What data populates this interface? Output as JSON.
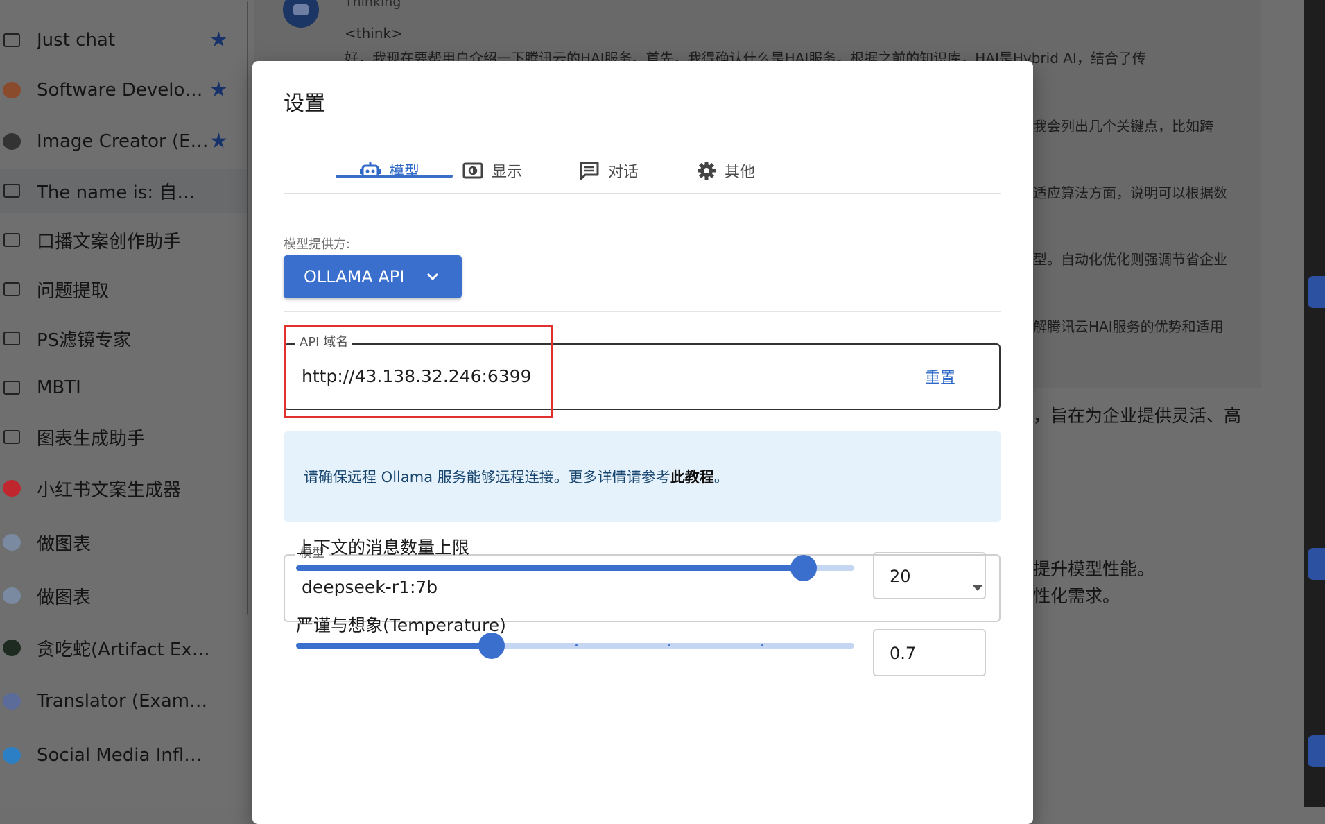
{
  "sidebar": {
    "items": [
      {
        "label": "Just chat",
        "icon": "chat-bubble-icon",
        "starred": true
      },
      {
        "label": "Software Develop…",
        "icon": "developer-avatar-icon",
        "starred": true
      },
      {
        "label": "Image Creator (E…",
        "icon": "image-icon",
        "starred": true
      },
      {
        "label": "The name is: 自我介绍",
        "icon": "chat-bubble-icon",
        "starred": false,
        "active": true
      },
      {
        "label": "口播文案创作助手",
        "icon": "chat-bubble-icon",
        "starred": false
      },
      {
        "label": "问题提取",
        "icon": "chat-bubble-icon",
        "starred": false
      },
      {
        "label": "PS滤镜专家",
        "icon": "chat-bubble-icon",
        "starred": false
      },
      {
        "label": "MBTI",
        "icon": "chat-bubble-icon",
        "starred": false
      },
      {
        "label": "图表生成助手",
        "icon": "chat-bubble-icon",
        "starred": false
      },
      {
        "label": "小红书文案生成器",
        "icon": "xiaohongshu-avatar-icon",
        "starred": false
      },
      {
        "label": "做图表",
        "icon": "chart-avatar-icon",
        "starred": false
      },
      {
        "label": "做图表",
        "icon": "chart-avatar-icon",
        "starred": false
      },
      {
        "label": "贪吃蛇(Artifact Example)",
        "icon": "snake-game-avatar-icon",
        "starred": false
      },
      {
        "label": "Translator (Example)",
        "icon": "translator-avatar-icon",
        "starred": false
      },
      {
        "label": "Social Media Influence…",
        "icon": "twitter-avatar-icon",
        "starred": false
      }
    ]
  },
  "chat": {
    "thinking_label": "Thinking",
    "think_tag": "<think>",
    "line1": "好，我现在要帮用户介绍一下腾讯云的HAI服务。首先，我得确认什么是HAI服务。根据之前的知识库，HAI是Hybrid AI，结合了传",
    "line2": "我会列出几个关键点，比如跨",
    "line3": "适应算法方面，说明可以根据数",
    "line4": "型。自动化优化则强调节省企业",
    "line5": "解腾讯云HAI服务的优势和适用",
    "line6": "，旨在为企业提供灵活、高",
    "line7": "提升模型性能。",
    "line8": "性化需求。"
  },
  "dialog": {
    "title": "设置",
    "tabs": [
      {
        "label": "模型",
        "icon": "robot-icon",
        "active": true
      },
      {
        "label": "显示",
        "icon": "display-icon",
        "active": false
      },
      {
        "label": "对话",
        "icon": "chat-message-icon",
        "active": false
      },
      {
        "label": "其他",
        "icon": "gear-icon",
        "active": false
      }
    ],
    "provider_label": "模型提供方:",
    "provider_value": "OLLAMA API",
    "api_field": {
      "label": "API 域名",
      "value": "http://43.138.32.246:6399",
      "reset_label": "重置"
    },
    "info": {
      "text": "请确保远程 Ollama 服务能够远程连接。更多详情请参考",
      "link": "此教程",
      "suffix": "。"
    },
    "model_field": {
      "label": "模型",
      "value": "deepseek-r1:7b"
    },
    "context_limit": {
      "label": "上下文的消息数量上限",
      "value": "20",
      "fraction": 0.909
    },
    "temperature": {
      "label": "严谨与想象(Temperature)",
      "value": "0.7",
      "fraction": 0.35
    }
  },
  "colors": {
    "accent": "#3a6fce",
    "highlight_box": "#e0312f",
    "info_bg": "#e6f2fb"
  }
}
